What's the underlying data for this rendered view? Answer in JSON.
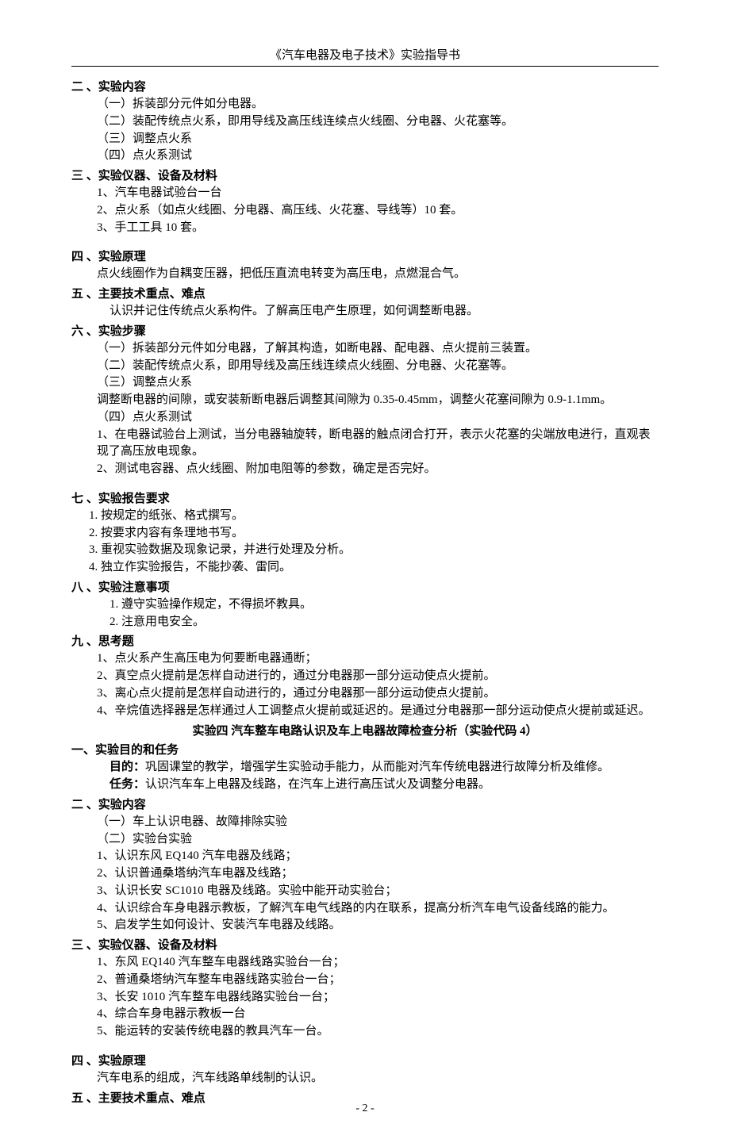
{
  "header": "《汽车电器及电子技术》实验指导书",
  "s2": {
    "title": "二 、实验内容",
    "items": [
      "（一）拆装部分元件如分电器。",
      "（二）装配传统点火系，即用导线及高压线连续点火线圈、分电器、火花塞等。",
      "（三）调整点火系",
      "（四）点火系测试"
    ]
  },
  "s3": {
    "title": "三 、实验仪器、设备及材料",
    "items": [
      "1、汽车电器试验台一台",
      "2、点火系（如点火线圈、分电器、高压线、火花塞、导线等）10 套。",
      "3、手工工具 10 套。"
    ]
  },
  "s4": {
    "title": "四 、实验原理",
    "text": "点火线圈作为自耦变压器，把低压直流电转变为高压电，点燃混合气。"
  },
  "s5": {
    "title": "五 、主要技术重点、难点",
    "text": "认识并记住传统点火系构件。了解高压电产生原理，如何调整断电器。"
  },
  "s6": {
    "title": "六 、实验步骤",
    "items": [
      "（一）拆装部分元件如分电器，了解其构造，如断电器、配电器、点火提前三装置。",
      "（二）装配传统点火系，即用导线及高压线连续点火线圈、分电器、火花塞等。",
      "（三）调整点火系",
      "调整断电器的间隙，或安装新断电器后调整其间隙为 0.35-0.45mm，调整火花塞间隙为 0.9-1.1mm。",
      "（四）点火系测试"
    ],
    "p1": "1、在电器试验台上测试，当分电器轴旋转，断电器的触点闭合打开，表示火花塞的尖端放电进行，直观表现了高压放电现象。",
    "p2": "2、测试电容器、点火线圈、附加电阻等的参数，确定是否完好。"
  },
  "s7": {
    "title": "七 、实验报告要求",
    "items": [
      "1. 按规定的纸张、格式撰写。",
      "2. 按要求内容有条理地书写。",
      "3. 重视实验数据及现象记录，并进行处理及分析。",
      "4. 独立作实验报告，不能抄袭、雷同。"
    ]
  },
  "s8": {
    "title": "八 、实验注意事项",
    "items": [
      "1. 遵守实验操作规定，不得损坏教具。",
      "2. 注意用电安全。"
    ]
  },
  "s9": {
    "title": "九 、思考题",
    "items": [
      "1、点火系产生高压电为何要断电器通断；",
      "2、真空点火提前是怎样自动进行的，通过分电器那一部分运动使点火提前。",
      "3、离心点火提前是怎样自动进行的，通过分电器那一部分运动使点火提前。",
      "4、辛烷值选择器是怎样通过人工调整点火提前或延迟的。是通过分电器那一部分运动使点火提前或延迟。"
    ]
  },
  "exp4_title": "实验四    汽车整车电路认识及车上电器故障检查分析（实验代码 4）",
  "exp4_s1": {
    "title": "一、实验目的和任务",
    "goal_label": "目的：",
    "goal": "巩固课堂的教学，增强学生实验动手能力，从而能对汽车传统电器进行故障分析及维修。",
    "task_label": "任务：",
    "task": "认识汽车车上电器及线路，在汽车上进行高压试火及调整分电器。"
  },
  "exp4_s2": {
    "title": "二 、实验内容",
    "items": [
      "（一）车上认识电器、故障排除实验",
      "（二）实验台实验",
      "1、认识东风 EQ140 汽车电器及线路；",
      "2、认识普通桑塔纳汽车电器及线路；",
      "3、认识长安 SC1010 电器及线路。实验中能开动实验台；",
      "4、认识综合车身电器示教板，了解汽车电气线路的内在联系，提高分析汽车电气设备线路的能力。",
      "5、启发学生如何设计、安装汽车电器及线路。"
    ]
  },
  "exp4_s3": {
    "title": "三 、实验仪器、设备及材料",
    "items": [
      "1、东风 EQ140 汽车整车电器线路实验台一台；",
      "2、普通桑塔纳汽车整车电器线路实验台一台；",
      "3、长安 1010 汽车整车电器线路实验台一台；",
      "4、综合车身电器示教板一台",
      "5、能运转的安装传统电器的教具汽车一台。"
    ]
  },
  "exp4_s4": {
    "title": "四 、实验原理",
    "text": "汽车电系的组成，汽车线路单线制的认识。"
  },
  "exp4_s5": {
    "title": "五 、主要技术重点、难点"
  },
  "page_number": "- 2 -"
}
